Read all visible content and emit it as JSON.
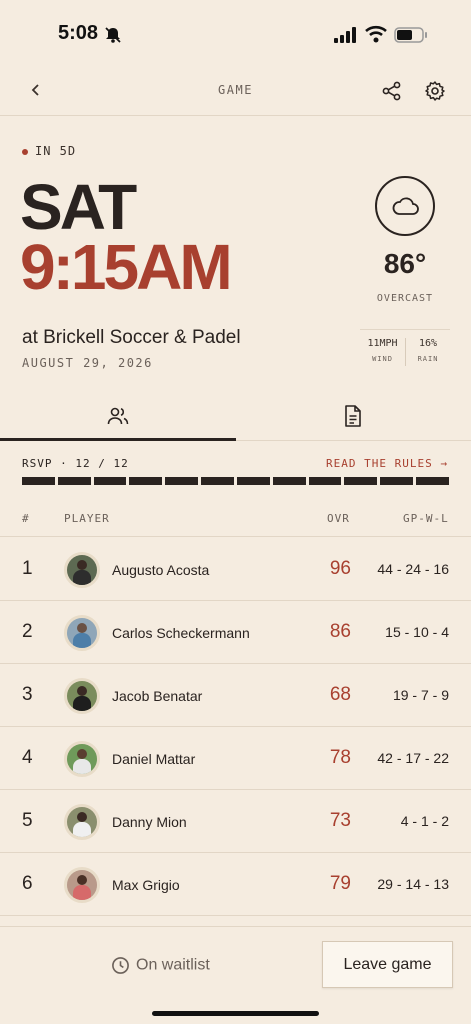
{
  "status_bar": {
    "time": "5:08"
  },
  "header": {
    "title": "GAME"
  },
  "event": {
    "countdown": "IN 5D",
    "day": "SAT",
    "time": "9:15AM",
    "venue": "at Brickell Soccer & Padel",
    "date": "AUGUST 29, 2026"
  },
  "weather": {
    "icon": "cloud-icon",
    "temp": "86°",
    "condition": "OVERCAST",
    "wind_value": "11MPH",
    "wind_label": "WIND",
    "rain_value": "16%",
    "rain_label": "RAIN"
  },
  "rsvp": {
    "label": "RSVP · 12 / 12",
    "filled": 12,
    "total": 12,
    "rules_link": "READ THE RULES →"
  },
  "table": {
    "headers": {
      "num": "#",
      "player": "PLAYER",
      "ovr": "OVR",
      "record": "GP-W-L"
    },
    "rows": [
      {
        "num": "1",
        "name": "Augusto Acosta",
        "ovr": "96",
        "record": "44 - 24 - 16"
      },
      {
        "num": "2",
        "name": "Carlos Scheckermann",
        "ovr": "86",
        "record": "15 - 10 - 4"
      },
      {
        "num": "3",
        "name": "Jacob Benatar",
        "ovr": "68",
        "record": "19 - 7 - 9"
      },
      {
        "num": "4",
        "name": "Daniel Mattar",
        "ovr": "78",
        "record": "42 - 17 - 22"
      },
      {
        "num": "5",
        "name": "Danny Mion",
        "ovr": "73",
        "record": "4 - 1 - 2"
      },
      {
        "num": "6",
        "name": "Max Grigio",
        "ovr": "79",
        "record": "29 - 14 - 13"
      }
    ]
  },
  "footer": {
    "waitlist_label": "On waitlist",
    "leave_label": "Leave game"
  },
  "colors": {
    "accent": "#a8402f",
    "background": "#f5ece0",
    "ink": "#2a2320"
  }
}
